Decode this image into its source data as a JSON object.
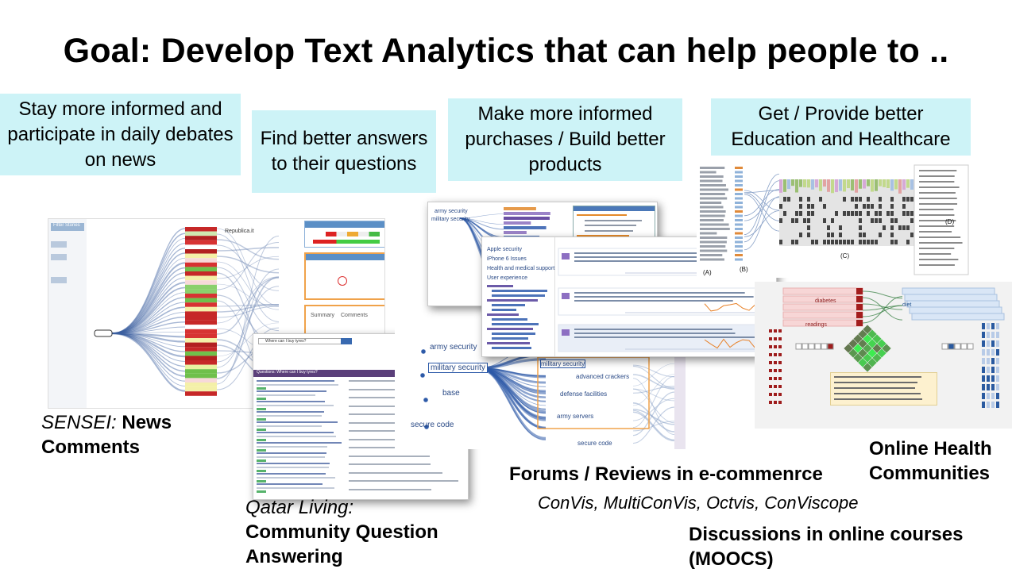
{
  "slide": {
    "title": "Goal: Develop Text Analytics that can help people to .."
  },
  "goals": [
    {
      "label": "Stay more informed and participate in daily debates on news"
    },
    {
      "label": "Find better answers to their questions"
    },
    {
      "label": "Make more informed purchases / Build better products"
    },
    {
      "label": "Get / Provide better Education and Healthcare"
    }
  ],
  "captions": {
    "sensei_name": "SENSEI:",
    "sensei_desc_1": "News",
    "sensei_desc_2": "Comments",
    "qatar_name": "Qatar Living:",
    "qatar_desc_1": "Community Question",
    "qatar_desc_2": "Answering",
    "forums": "Forums / Reviews in e-commenrce",
    "tools": "ConVis, MultiConVis, Octvis, ConViscope",
    "health_1": "Online Health",
    "health_2": "Communities",
    "moocs_1": "Discussions in online courses",
    "moocs_2": "(MOOCS)"
  },
  "screenshot_labels": {
    "sensei_filter": "Filter Stories",
    "sensei_republic": "Republica.it",
    "qatar_question": "Where can I buy tyres?",
    "qatar_section": "Questions: Where can I buy tyres?",
    "qatar_summary_tab": "Summary",
    "qatar_comments_tab": "Comments",
    "forum_main_label": "military security",
    "forum_labels": [
      "army security",
      "base",
      "secure code",
      "advanced crackers",
      "defense facilities",
      "army servers",
      "secure code"
    ],
    "multiconvis_labels": [
      "Apple security",
      "iPhone 6 Issues",
      "Health and medical support",
      "User experience"
    ],
    "panel_labels": [
      "(A)",
      "(B)",
      "(C)",
      "(D)"
    ],
    "health_labels": [
      "diabetes",
      "diet",
      "readings"
    ]
  },
  "colors": {
    "goal_box": "#cdf3f7",
    "accent_blue": "#2f5faa",
    "accent_orange": "#e8822a"
  }
}
